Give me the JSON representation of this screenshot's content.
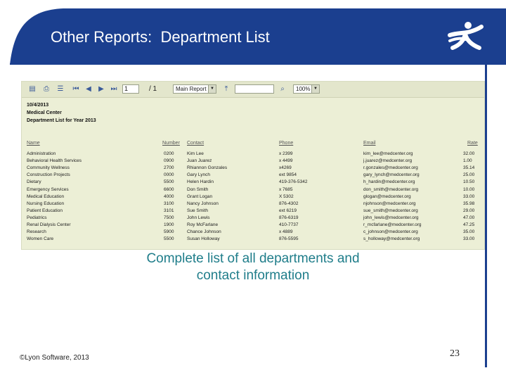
{
  "slide": {
    "title": "Other Reports:  Department List",
    "caption_line1": "Complete list of all departments and",
    "caption_line2": "contact information",
    "copyright": "©Lyon Software, 2013",
    "page_number": "23",
    "colors": {
      "header_blue": "#1b3f8f",
      "caption_teal": "#1f7d8a",
      "report_bg": "#ecefd6"
    }
  },
  "toolbar": {
    "page_input": "1",
    "page_total": "/ 1",
    "report_select": "Main Report",
    "search_input": "",
    "zoom_select": "100%",
    "icons": [
      "export-icon",
      "print-icon",
      "group-tree-icon",
      "first-page-icon",
      "prev-page-icon",
      "next-page-icon",
      "last-page-icon",
      "drill-up-icon",
      "search-icon"
    ]
  },
  "report": {
    "date": "10/4/2013",
    "org": "Medical Center",
    "heading": "Department List for Year 2013",
    "columns": {
      "name": "Name",
      "number": "Number",
      "contact": "Contact",
      "phone": "Phone",
      "email": "Email",
      "rate": "Rate"
    },
    "rows": [
      {
        "name": "Administration",
        "number": "0200",
        "contact": "Kim Lee",
        "phone": "x 2399",
        "email": "kim_lee@medcenter.org",
        "rate": "32.00"
      },
      {
        "name": "Behavioral Health Services",
        "number": "0900",
        "contact": "Juan Juarez",
        "phone": "x 4499",
        "email": "j.juarez@medcenter.org",
        "rate": "1.00"
      },
      {
        "name": "Community Wellness",
        "number": "2700",
        "contact": "Rhiannon Gonzales",
        "phone": "x4269",
        "email": "r.gonzales@medcenter.org",
        "rate": "35.14"
      },
      {
        "name": "Construction Projects",
        "number": "0000",
        "contact": "Gary Lynch",
        "phone": "ext 9854",
        "email": "gary_lynch@medcenter.org",
        "rate": "25.00"
      },
      {
        "name": "Dietary",
        "number": "5500",
        "contact": "Helen Hardin",
        "phone": "419-376-5342",
        "email": "h_hardin@medcenter.org",
        "rate": "10.50"
      },
      {
        "name": "Emergency Services",
        "number": "6600",
        "contact": "Don Smith",
        "phone": "x 7685",
        "email": "don_smith@medcenter.org",
        "rate": "10.00"
      },
      {
        "name": "Medical Education",
        "number": "4000",
        "contact": "Grant Logan",
        "phone": "X 5302",
        "email": "glogan@medcenter.org",
        "rate": "33.00"
      },
      {
        "name": "Nursing Education",
        "number": "3100",
        "contact": "Nancy Johnson",
        "phone": "876-4302",
        "email": "njohnson@medcenter.org",
        "rate": "35.98"
      },
      {
        "name": "Patient Education",
        "number": "3101",
        "contact": "Sue Smith",
        "phone": "ext 6219",
        "email": "sue_smith@medcenter.org",
        "rate": "29.00"
      },
      {
        "name": "Pediatrics",
        "number": "7500",
        "contact": "John Lewis",
        "phone": "876-6319",
        "email": "john_lewis@medcenter.org",
        "rate": "47.00"
      },
      {
        "name": "Renal Dialysis Center",
        "number": "1900",
        "contact": "Roy McFarlane",
        "phone": "410-7737",
        "email": "r_mcfarlane@medcenter.org",
        "rate": "47.25"
      },
      {
        "name": "Research",
        "number": "5900",
        "contact": "Chance Johnson",
        "phone": "x 4889",
        "email": "c_johnson@medcenter.org",
        "rate": "35.00"
      },
      {
        "name": "Women Care",
        "number": "5500",
        "contact": "Susan Holloway",
        "phone": "876-5595",
        "email": "s_holloway@medcenter.org",
        "rate": "33.00"
      }
    ]
  }
}
